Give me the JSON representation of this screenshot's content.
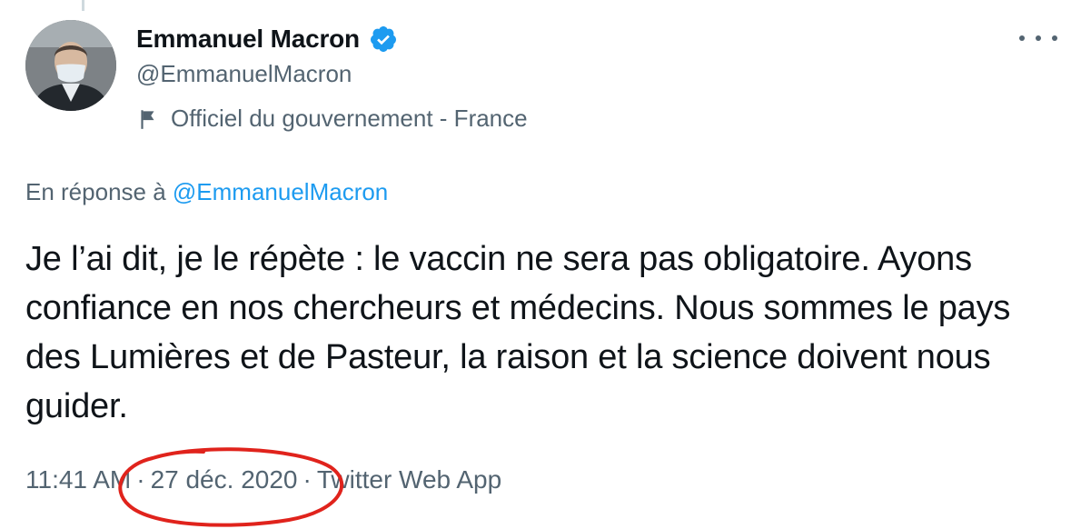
{
  "author": {
    "display_name": "Emmanuel Macron",
    "handle": "@EmmanuelMacron",
    "affiliation": "Officiel du gouvernement - France",
    "verified": true
  },
  "reply": {
    "prefix": "En réponse à",
    "mention": "@EmmanuelMacron"
  },
  "tweet": {
    "text": "Je l’ai dit, je le répète : le vaccin ne sera pas obligatoire. Ayons confiance en nos chercheurs et médecins. Nous sommes le pays des Lumières et de Pasteur, la raison et la science doivent nous guider."
  },
  "meta": {
    "time": "11:41 AM",
    "separator": "·",
    "date": "27 déc. 2020",
    "source": "Twitter Web App"
  },
  "icons": {
    "verified": "verified-badge-icon",
    "flag": "flag-icon",
    "more": "more-options-icon"
  },
  "colors": {
    "text_primary": "#0f1419",
    "text_secondary": "#536471",
    "accent": "#1d9bf0",
    "annotation": "#e0231c"
  }
}
